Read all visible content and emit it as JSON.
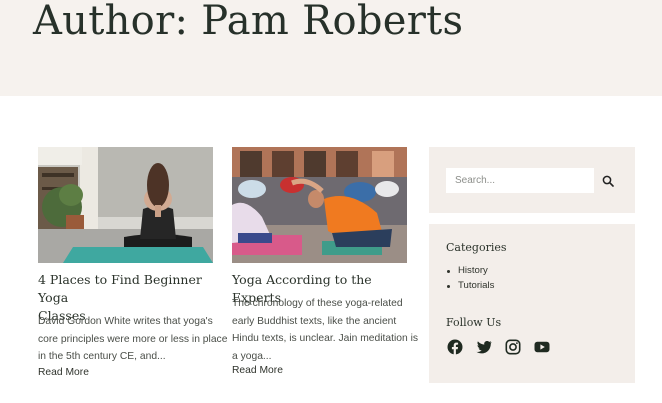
{
  "header": {
    "title": "Author: Pam Roberts"
  },
  "posts": [
    {
      "title_line1": "4 Places to Find Beginner Yoga",
      "title_line2": "Classes",
      "excerpt_lines": [
        "David Gordon White writes that yoga's",
        "core principles were more or less in place",
        "in the 5th century CE, and..."
      ],
      "read_more": "Read More"
    },
    {
      "title_line1": "Yoga According to the Experts",
      "excerpt_lines": [
        "The chronology of these yoga-related",
        "early Buddhist texts, like the ancient",
        "Hindu texts, is unclear. Jain meditation is",
        "a yoga..."
      ],
      "read_more": "Read More"
    }
  ],
  "sidebar": {
    "search": {
      "placeholder": "Search..."
    },
    "categories": {
      "title": "Categories",
      "items": [
        "History",
        "Tutorials"
      ]
    },
    "follow": {
      "title": "Follow Us",
      "icons": [
        "facebook-icon",
        "twitter-icon",
        "instagram-icon",
        "youtube-icon"
      ]
    }
  }
}
